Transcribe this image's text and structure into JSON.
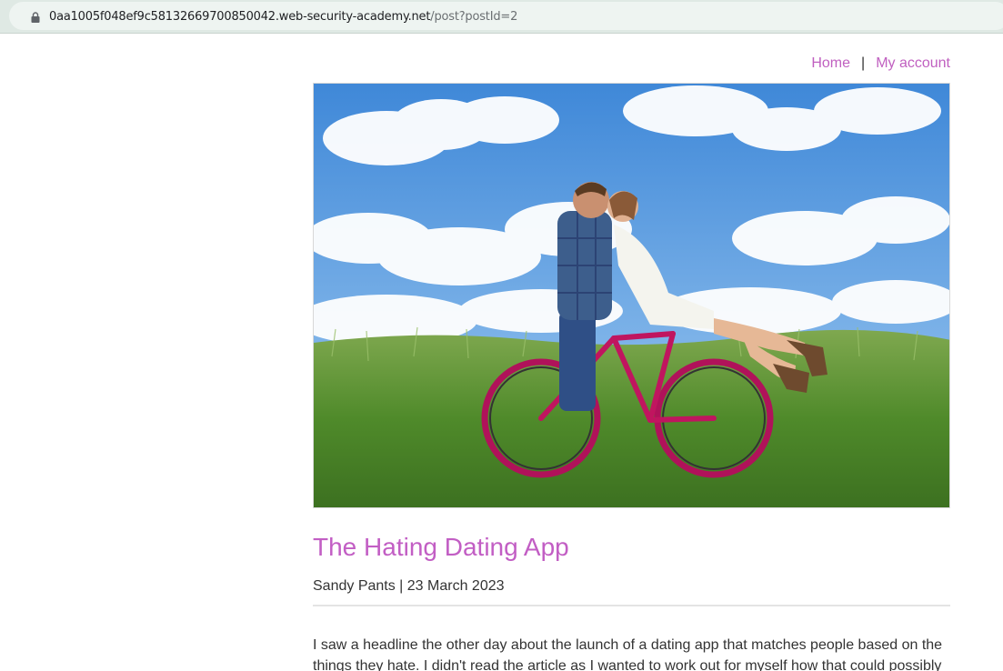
{
  "browser": {
    "url_host": "0aa1005f048ef9c58132669700850042.web-security-academy.net",
    "url_path": "/post?postId=2"
  },
  "nav": {
    "home": "Home",
    "separator": "|",
    "my_account": "My account"
  },
  "post": {
    "image_icon": "couple-on-bicycle-photo",
    "title": "The Hating Dating App",
    "byline": "Sandy Pants | 23 March 2023",
    "body": "I saw a headline the other day about the launch of a dating app that matches people based on the things they hate. I didn't read the article as I wanted to work out for myself how that could possibly"
  },
  "colors": {
    "link": "#c060c0",
    "title": "#c25ec4",
    "text": "#333333"
  }
}
